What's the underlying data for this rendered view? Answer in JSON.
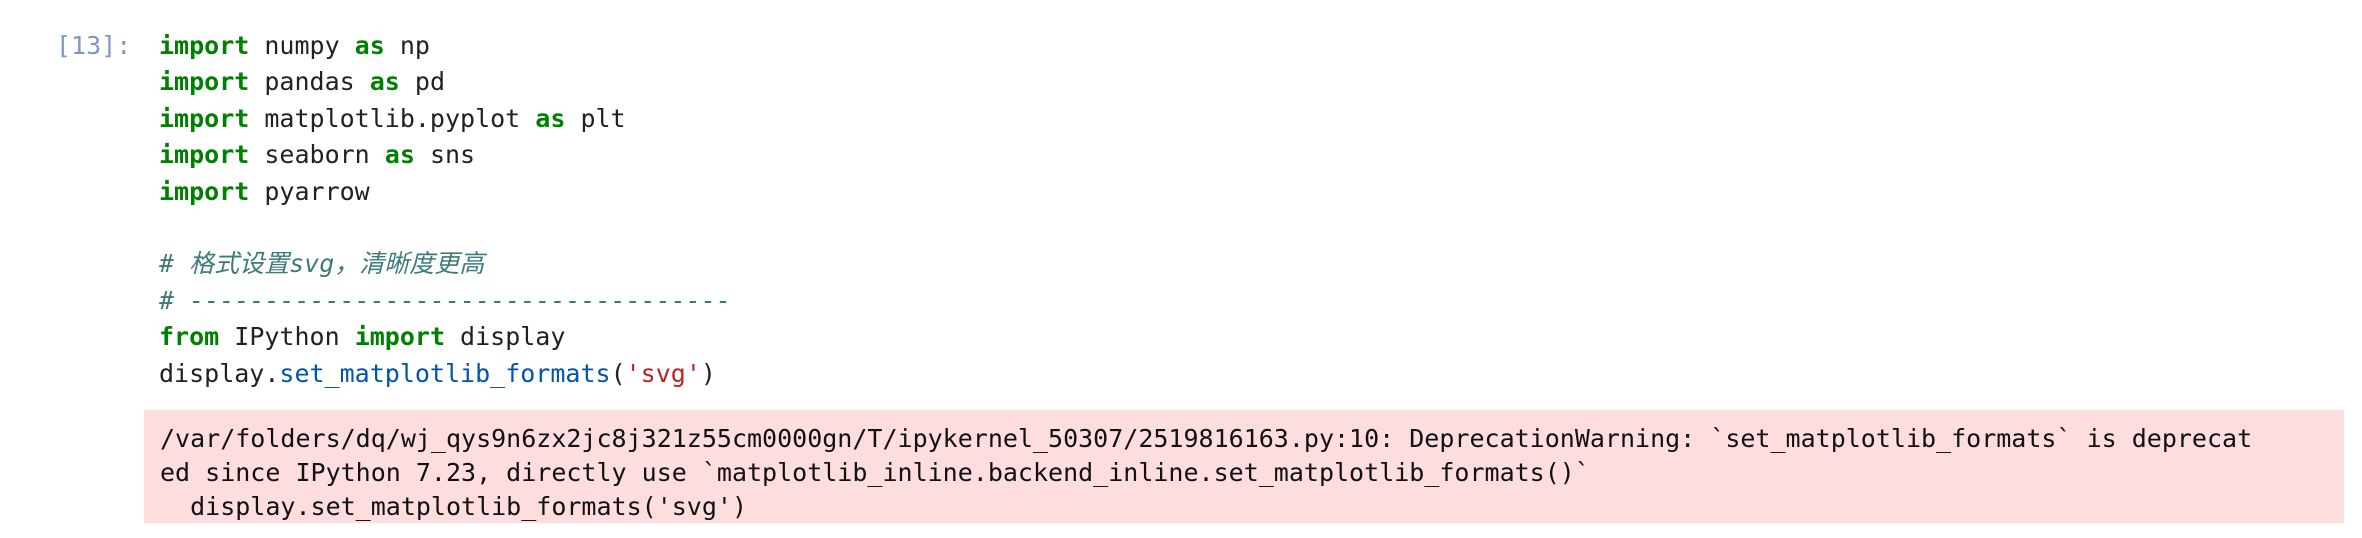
{
  "cell": {
    "prompt": "[13]:",
    "code": {
      "l1": {
        "kw1": "import",
        "t1": " numpy ",
        "kw2": "as",
        "t2": " np"
      },
      "l2": {
        "kw1": "import",
        "t1": " pandas ",
        "kw2": "as",
        "t2": " pd"
      },
      "l3": {
        "kw1": "import",
        "t1": " matplotlib.pyplot ",
        "kw2": "as",
        "t2": " plt"
      },
      "l4": {
        "kw1": "import",
        "t1": " seaborn ",
        "kw2": "as",
        "t2": " sns"
      },
      "l5": {
        "kw1": "import",
        "t1": " pyarrow"
      },
      "l7": {
        "comment": "# 格式设置svg，清晰度更高"
      },
      "l8": {
        "comment": "# ------------------------------------"
      },
      "l9": {
        "kw1": "from",
        "t1": " IPython ",
        "kw2": "import",
        "t2": " display"
      },
      "l10": {
        "obj": "display.",
        "fn": "set_matplotlib_formats",
        "open": "(",
        "str": "'svg'",
        "close": ")"
      }
    },
    "stderr": {
      "line1": "/var/folders/dq/wj_qys9n6zx2jc8j321z55cm0000gn/T/ipykernel_50307/2519816163.py:10: DeprecationWarning: `set_matplotlib_formats` is deprecat",
      "line2": "ed since IPython 7.23, directly use `matplotlib_inline.backend_inline.set_matplotlib_formats()`",
      "line3": "  display.set_matplotlib_formats('svg')"
    }
  }
}
